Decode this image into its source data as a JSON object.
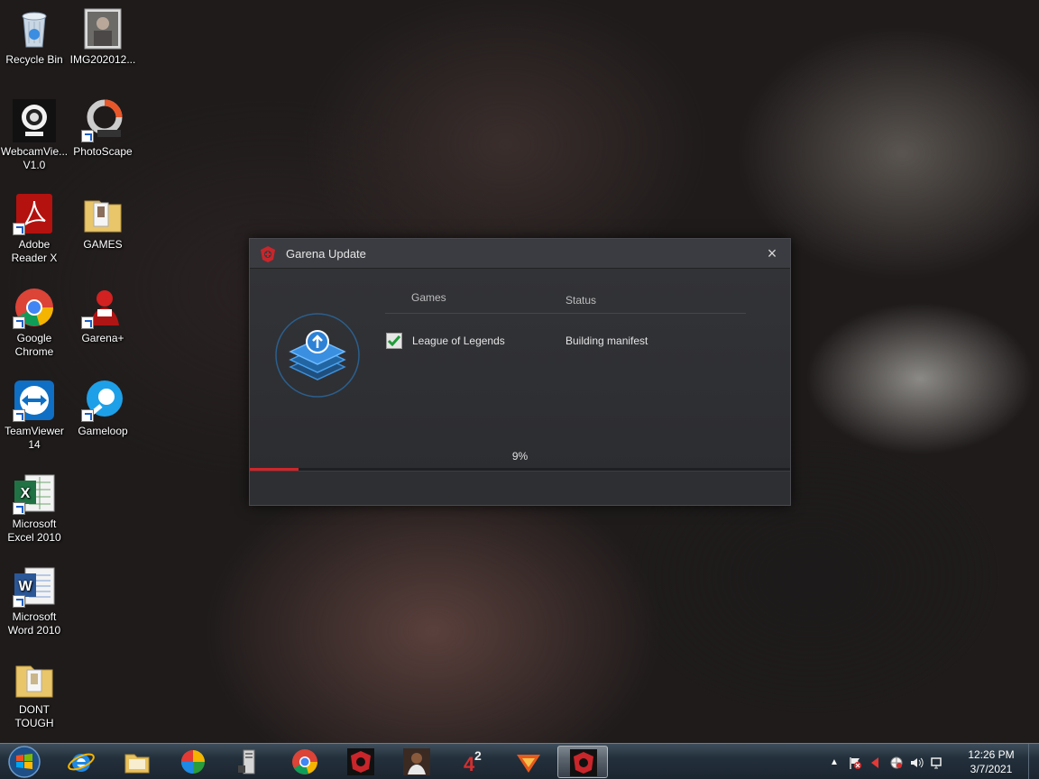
{
  "desktop": {
    "icons": [
      {
        "label": "Recycle Bin"
      },
      {
        "label": "IMG202012..."
      },
      {
        "label": "WebcamVie... V1.0"
      },
      {
        "label": "PhotoScape"
      },
      {
        "label": "Adobe Reader X"
      },
      {
        "label": "GAMES"
      },
      {
        "label": "Google Chrome"
      },
      {
        "label": "Garena+"
      },
      {
        "label": "TeamViewer 14"
      },
      {
        "label": "Gameloop"
      },
      {
        "label": "Microsoft Excel 2010"
      },
      {
        "label": "Microsoft Word 2010"
      },
      {
        "label": "DONT TOUGH"
      }
    ]
  },
  "window": {
    "title": "Garena Update",
    "close_glyph": "×",
    "columns": {
      "games": "Games",
      "status": "Status"
    },
    "rows": [
      {
        "game": "League of Legends",
        "status": "Building manifest",
        "checked": true
      }
    ],
    "progress_text": "9%",
    "progress_fraction": 0.09,
    "accent_color": "#d0252a"
  },
  "taskbar": {
    "pinned": [
      "start-orb",
      "internet-explorer-icon",
      "file-explorer-icon",
      "media-center-icon",
      "computer-tower-icon",
      "chrome-icon",
      "garena-icon",
      "game-character-icon",
      "game-4-icon",
      "garena-plus-icon",
      "garena-update-icon"
    ],
    "clock": {
      "time": "12:26 PM",
      "date": "3/7/2021"
    }
  }
}
